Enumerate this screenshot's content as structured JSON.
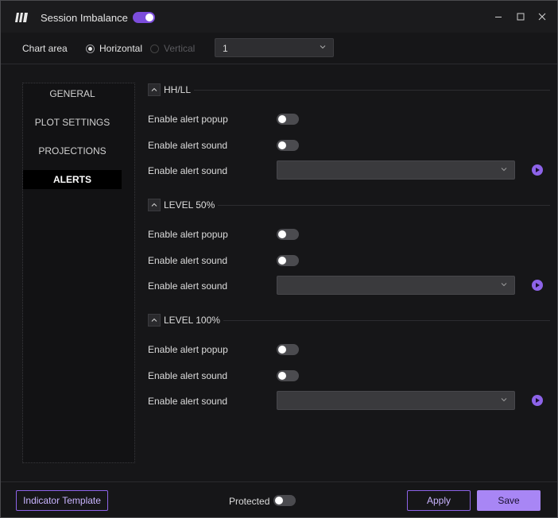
{
  "window": {
    "title": "Session Imbalance",
    "title_toggle_on": true,
    "logo_icon": "logo-icon"
  },
  "window_controls": {
    "minimize": "minimize-icon",
    "maximize": "maximize-icon",
    "close": "close-icon"
  },
  "chart_area": {
    "label": "Chart area",
    "options": [
      {
        "label": "Horizontal",
        "checked": true,
        "disabled": false
      },
      {
        "label": "Vertical",
        "checked": false,
        "disabled": true
      }
    ],
    "pane_select_value": "1"
  },
  "sidebar": {
    "items": [
      {
        "label": "GENERAL",
        "active": false
      },
      {
        "label": "PLOT SETTINGS",
        "active": false
      },
      {
        "label": "PROJECTIONS",
        "active": false
      },
      {
        "label": "ALERTS",
        "active": true
      }
    ]
  },
  "sections": [
    {
      "title": "HH/LL",
      "rows": [
        {
          "label": "Enable alert popup",
          "type": "toggle",
          "on": false
        },
        {
          "label": "Enable alert sound",
          "type": "toggle",
          "on": false
        },
        {
          "label": "Enable alert sound",
          "type": "select",
          "value": ""
        }
      ]
    },
    {
      "title": "LEVEL 50%",
      "rows": [
        {
          "label": "Enable alert popup",
          "type": "toggle",
          "on": false
        },
        {
          "label": "Enable alert sound",
          "type": "toggle",
          "on": false
        },
        {
          "label": "Enable alert sound",
          "type": "select",
          "value": ""
        }
      ]
    },
    {
      "title": "LEVEL 100%",
      "rows": [
        {
          "label": "Enable alert popup",
          "type": "toggle",
          "on": false
        },
        {
          "label": "Enable alert sound",
          "type": "toggle",
          "on": false
        },
        {
          "label": "Enable alert sound",
          "type": "select",
          "value": ""
        }
      ]
    }
  ],
  "footer": {
    "template_button": "Indicator Template",
    "protected_label": "Protected",
    "protected_on": false,
    "apply_button": "Apply",
    "save_button": "Save"
  },
  "colors": {
    "accent": "#8d63e8",
    "save_bg": "#a886f5",
    "window_bg": "#161618"
  }
}
